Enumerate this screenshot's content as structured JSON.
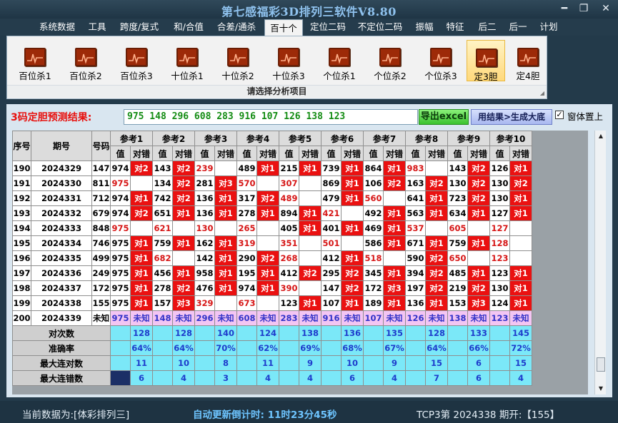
{
  "window": {
    "title": "第七感福彩3D排列三软件V8.80",
    "minimize": "━",
    "restore": "❐",
    "close": "✕"
  },
  "menu": [
    {
      "label": "系统数据",
      "active": false
    },
    {
      "label": "工具",
      "active": false
    },
    {
      "label": "跨度/复式",
      "active": false
    },
    {
      "label": "和/合值",
      "active": false
    },
    {
      "label": "合差/通杀",
      "active": false
    },
    {
      "label": "百十个",
      "active": true
    },
    {
      "label": "定位二码",
      "active": false
    },
    {
      "label": "不定位二码",
      "active": false
    },
    {
      "label": "振幅",
      "active": false
    },
    {
      "label": "特征",
      "active": false
    },
    {
      "label": "后二",
      "active": false
    },
    {
      "label": "后一",
      "active": false
    },
    {
      "label": "计划",
      "active": false
    }
  ],
  "ribbon": {
    "buttons": [
      {
        "label": "百位杀1",
        "icon": "chart-icon",
        "active": false
      },
      {
        "label": "百位杀2",
        "icon": "chart-icon",
        "active": false
      },
      {
        "label": "百位杀3",
        "icon": "chart-icon",
        "active": false
      },
      {
        "label": "十位杀1",
        "icon": "chart-icon",
        "active": false
      },
      {
        "label": "十位杀2",
        "icon": "chart-icon",
        "active": false
      },
      {
        "label": "十位杀3",
        "icon": "chart-icon",
        "active": false
      },
      {
        "label": "个位杀1",
        "icon": "chart-icon",
        "active": false
      },
      {
        "label": "个位杀2",
        "icon": "chart-icon",
        "active": false
      },
      {
        "label": "个位杀3",
        "icon": "chart-icon",
        "active": false
      },
      {
        "label": "定3胆",
        "icon": "chart-icon",
        "active": true
      },
      {
        "label": "定4胆",
        "icon": "chart-icon",
        "active": false
      }
    ],
    "caption": "请选择分析项目"
  },
  "prediction": {
    "label": "3码定胆预测结果:",
    "value": "975 148 296 608 283 916 107 126 138 123",
    "export_label": "导出excel",
    "generate_label": "用结果>生成大底",
    "topmost_label": "窗体置上",
    "topmost_checked": true
  },
  "table": {
    "fixed_headers": [
      "序号",
      "期号",
      "号码"
    ],
    "group_headers": [
      "参考1",
      "参考2",
      "参考3",
      "参考4",
      "参考5",
      "参考6",
      "参考7",
      "参考8",
      "参考9",
      "参考10"
    ],
    "sub_headers": [
      "值",
      "对错"
    ],
    "rows": [
      {
        "seq": "190",
        "period": "2024329",
        "number": "147",
        "cells": [
          [
            "974",
            "对2"
          ],
          [
            "143",
            "对2"
          ],
          [
            "239",
            ""
          ],
          [
            "489",
            "对1"
          ],
          [
            "215",
            "对1"
          ],
          [
            "739",
            "对1"
          ],
          [
            "864",
            "对1"
          ],
          [
            "983",
            ""
          ],
          [
            "143",
            "对2"
          ],
          [
            "126",
            "对1"
          ]
        ]
      },
      {
        "seq": "191",
        "period": "2024330",
        "number": "811",
        "cells": [
          [
            "975",
            ""
          ],
          [
            "134",
            "对2"
          ],
          [
            "281",
            "对3"
          ],
          [
            "570",
            ""
          ],
          [
            "307",
            ""
          ],
          [
            "869",
            "对1"
          ],
          [
            "106",
            "对2"
          ],
          [
            "163",
            "对2"
          ],
          [
            "130",
            "对2"
          ],
          [
            "130",
            "对2"
          ]
        ]
      },
      {
        "seq": "192",
        "period": "2024331",
        "number": "712",
        "cells": [
          [
            "974",
            "对1"
          ],
          [
            "742",
            "对2"
          ],
          [
            "136",
            "对1"
          ],
          [
            "317",
            "对2"
          ],
          [
            "489",
            ""
          ],
          [
            "479",
            "对1"
          ],
          [
            "560",
            ""
          ],
          [
            "641",
            "对1"
          ],
          [
            "723",
            "对2"
          ],
          [
            "130",
            "对1"
          ]
        ]
      },
      {
        "seq": "193",
        "period": "2024332",
        "number": "679",
        "cells": [
          [
            "974",
            "对2"
          ],
          [
            "651",
            "对1"
          ],
          [
            "136",
            "对1"
          ],
          [
            "278",
            "对1"
          ],
          [
            "894",
            "对1"
          ],
          [
            "421",
            ""
          ],
          [
            "492",
            "对1"
          ],
          [
            "563",
            "对1"
          ],
          [
            "634",
            "对1"
          ],
          [
            "127",
            "对1"
          ]
        ]
      },
      {
        "seq": "194",
        "period": "2024333",
        "number": "848",
        "cells": [
          [
            "975",
            ""
          ],
          [
            "621",
            ""
          ],
          [
            "130",
            ""
          ],
          [
            "265",
            ""
          ],
          [
            "405",
            "对1"
          ],
          [
            "401",
            "对1"
          ],
          [
            "469",
            "对1"
          ],
          [
            "537",
            ""
          ],
          [
            "605",
            ""
          ],
          [
            "127",
            ""
          ]
        ]
      },
      {
        "seq": "195",
        "period": "2024334",
        "number": "746",
        "cells": [
          [
            "975",
            "对1"
          ],
          [
            "759",
            "对1"
          ],
          [
            "162",
            "对1"
          ],
          [
            "319",
            ""
          ],
          [
            "351",
            ""
          ],
          [
            "501",
            ""
          ],
          [
            "586",
            "对1"
          ],
          [
            "671",
            "对1"
          ],
          [
            "759",
            "对1"
          ],
          [
            "128",
            ""
          ]
        ]
      },
      {
        "seq": "196",
        "period": "2024335",
        "number": "499",
        "cells": [
          [
            "975",
            "对1"
          ],
          [
            "682",
            ""
          ],
          [
            "142",
            "对1"
          ],
          [
            "290",
            "对2"
          ],
          [
            "268",
            ""
          ],
          [
            "412",
            "对1"
          ],
          [
            "518",
            ""
          ],
          [
            "590",
            "对2"
          ],
          [
            "650",
            ""
          ],
          [
            "123",
            ""
          ]
        ]
      },
      {
        "seq": "197",
        "period": "2024336",
        "number": "249",
        "cells": [
          [
            "975",
            "对1"
          ],
          [
            "456",
            "对1"
          ],
          [
            "958",
            "对1"
          ],
          [
            "195",
            "对1"
          ],
          [
            "412",
            "对2"
          ],
          [
            "295",
            "对2"
          ],
          [
            "345",
            "对1"
          ],
          [
            "394",
            "对2"
          ],
          [
            "485",
            "对1"
          ],
          [
            "123",
            "对1"
          ]
        ]
      },
      {
        "seq": "198",
        "period": "2024337",
        "number": "172",
        "cells": [
          [
            "975",
            "对1"
          ],
          [
            "278",
            "对2"
          ],
          [
            "476",
            "对1"
          ],
          [
            "974",
            "对1"
          ],
          [
            "390",
            ""
          ],
          [
            "147",
            "对2"
          ],
          [
            "172",
            "对3"
          ],
          [
            "197",
            "对2"
          ],
          [
            "219",
            "对2"
          ],
          [
            "130",
            "对1"
          ]
        ]
      },
      {
        "seq": "199",
        "period": "2024338",
        "number": "155",
        "cells": [
          [
            "975",
            "对1"
          ],
          [
            "157",
            "对3"
          ],
          [
            "329",
            ""
          ],
          [
            "673",
            ""
          ],
          [
            "123",
            "对1"
          ],
          [
            "107",
            "对1"
          ],
          [
            "189",
            "对1"
          ],
          [
            "136",
            "对1"
          ],
          [
            "153",
            "对3"
          ],
          [
            "124",
            "对1"
          ]
        ]
      }
    ],
    "pending_row": {
      "seq": "200",
      "period": "2024339",
      "number": "未知",
      "cells": [
        [
          "975",
          "未知"
        ],
        [
          "148",
          "未知"
        ],
        [
          "296",
          "未知"
        ],
        [
          "608",
          "未知"
        ],
        [
          "283",
          "未知"
        ],
        [
          "916",
          "未知"
        ],
        [
          "107",
          "未知"
        ],
        [
          "126",
          "未知"
        ],
        [
          "138",
          "未知"
        ],
        [
          "123",
          "未知"
        ]
      ]
    },
    "stats": [
      {
        "label": "对次数",
        "values": [
          "128",
          "128",
          "140",
          "124",
          "138",
          "136",
          "135",
          "128",
          "133",
          "145"
        ]
      },
      {
        "label": "准确率",
        "values": [
          "64%",
          "64%",
          "70%",
          "62%",
          "69%",
          "68%",
          "67%",
          "64%",
          "66%",
          "72%"
        ]
      },
      {
        "label": "最大连对数",
        "values": [
          "11",
          "10",
          "8",
          "11",
          "9",
          "10",
          "9",
          "15",
          "6",
          "15"
        ]
      },
      {
        "label": "最大连错数",
        "values": [
          "6",
          "4",
          "3",
          "4",
          "4",
          "6",
          "4",
          "7",
          "6",
          "4"
        ]
      }
    ]
  },
  "status": {
    "data_source": "当前数据为:[体彩排列三]",
    "countdown": "自动更新倒计时: 11时23分45秒",
    "tcp": "TCP3第 2024338 期开:【155】"
  },
  "colors": {
    "hit": "#ea1111",
    "pending": "#f3c5f3",
    "stats": "#7be8f8",
    "title": "#8fc2ee"
  }
}
